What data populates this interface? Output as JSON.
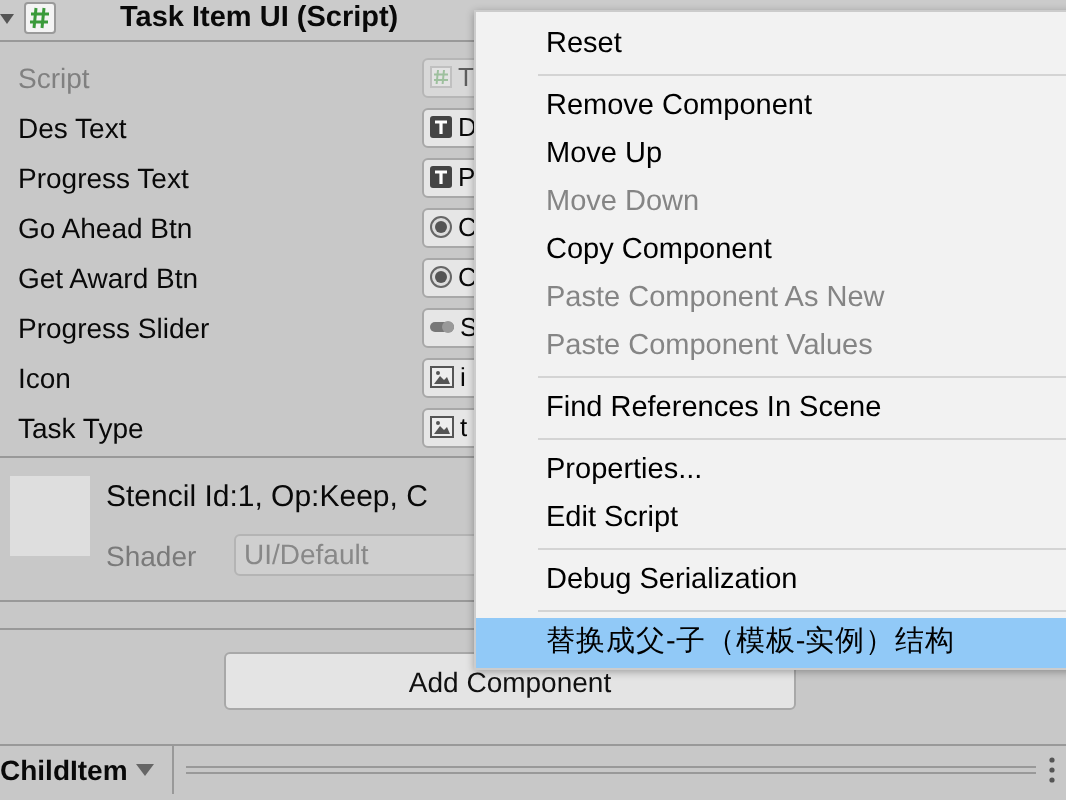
{
  "component": {
    "title": "Task Item UI (Script)",
    "expanded": true
  },
  "properties": [
    {
      "label": "Script",
      "value": "T",
      "kind": "script",
      "disabled": true
    },
    {
      "label": "Des Text",
      "value": "D",
      "kind": "text",
      "disabled": false
    },
    {
      "label": "Progress Text",
      "value": "P",
      "kind": "text",
      "disabled": false
    },
    {
      "label": "Go Ahead Btn",
      "value": "C",
      "kind": "button",
      "disabled": false
    },
    {
      "label": "Get Award Btn",
      "value": "C",
      "kind": "button",
      "disabled": false
    },
    {
      "label": "Progress Slider",
      "value": "S",
      "kind": "slider",
      "disabled": false
    },
    {
      "label": "Icon",
      "value": "i",
      "kind": "image",
      "disabled": false
    },
    {
      "label": "Task Type",
      "value": "t",
      "kind": "image",
      "disabled": false
    }
  ],
  "material": {
    "name": "Stencil Id:1, Op:Keep, C",
    "shader_label": "Shader",
    "shader": "UI/Default"
  },
  "add_component": "Add Component",
  "bottom_bar": {
    "label": "ChildItem"
  },
  "context_menu": [
    [
      {
        "label": "Reset",
        "disabled": false,
        "selected": false
      }
    ],
    [
      {
        "label": "Remove Component",
        "disabled": false,
        "selected": false
      },
      {
        "label": "Move Up",
        "disabled": false,
        "selected": false
      },
      {
        "label": "Move Down",
        "disabled": true,
        "selected": false
      },
      {
        "label": "Copy Component",
        "disabled": false,
        "selected": false
      },
      {
        "label": "Paste Component As New",
        "disabled": true,
        "selected": false
      },
      {
        "label": "Paste Component Values",
        "disabled": true,
        "selected": false
      }
    ],
    [
      {
        "label": "Find References In Scene",
        "disabled": false,
        "selected": false
      }
    ],
    [
      {
        "label": "Properties...",
        "disabled": false,
        "selected": false
      },
      {
        "label": "Edit Script",
        "disabled": false,
        "selected": false
      }
    ],
    [
      {
        "label": "Debug Serialization",
        "disabled": false,
        "selected": false
      }
    ],
    [
      {
        "label": "替换成父-子（模板-实例）结构",
        "disabled": false,
        "selected": true
      }
    ]
  ]
}
